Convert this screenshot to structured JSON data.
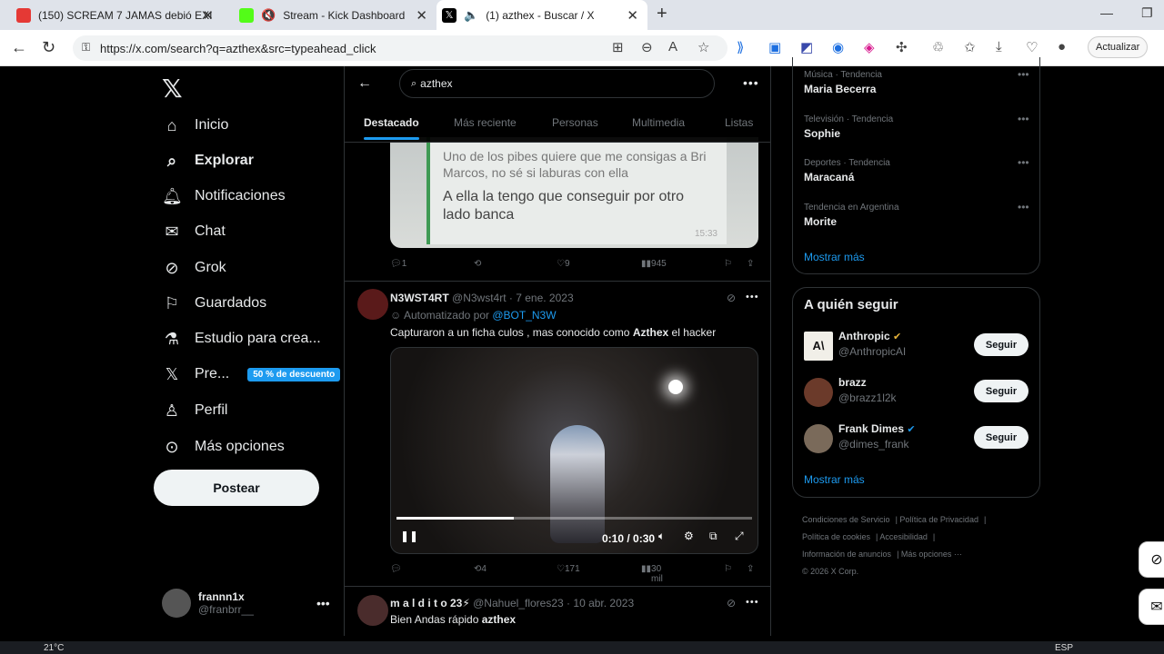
{
  "browser": {
    "tabs": [
      {
        "title": "(150) SCREAM 7 JAMAS debió EXI",
        "favicon_color": "#e53935"
      },
      {
        "title": "Stream - Kick Dashboard",
        "favicon_color": "#53fc18"
      },
      {
        "title": "(1) azthex - Buscar / X",
        "favicon_color": "#000000"
      }
    ],
    "url": "https://x.com/search?q=azthex&src=typeahead_click",
    "update_label": "Actualizar"
  },
  "nav": {
    "items": [
      {
        "label": "Inicio",
        "icon": "home-icon"
      },
      {
        "label": "Explorar",
        "icon": "search-icon"
      },
      {
        "label": "Notificaciones",
        "icon": "bell-icon"
      },
      {
        "label": "Chat",
        "icon": "mail-icon"
      },
      {
        "label": "Grok",
        "icon": "grok-icon"
      },
      {
        "label": "Guardados",
        "icon": "bookmark-icon"
      },
      {
        "label": "Estudio para crea...",
        "icon": "studio-icon"
      },
      {
        "label": "Pre...",
        "icon": "x-premium-icon"
      },
      {
        "label": "Perfil",
        "icon": "person-icon"
      },
      {
        "label": "Más opciones",
        "icon": "more-circle-icon"
      }
    ],
    "promo_badge": "50 % de descuento",
    "post_button": "Postear",
    "account": {
      "name": "frannn1x",
      "handle": "@franbrr__"
    }
  },
  "search": {
    "query": "azthex",
    "tabs": [
      "Destacado",
      "Más reciente",
      "Personas",
      "Multimedia",
      "Listas"
    ]
  },
  "tweets": [
    {
      "image_lines": [
        "Uno de los pibes quiere que me consigas a Bri Marcos, no sé si laburas con ella",
        "A ella la tengo que conseguir por otro lado banca",
        "15:33"
      ],
      "replies": "1",
      "retweets": "",
      "likes": "9",
      "views": "945"
    },
    {
      "name": "N3WST4RT",
      "handle": "@N3wst4rt",
      "date": "7 ene. 2023",
      "automated_prefix": "Automatizado por",
      "automated_by": "@BOT_N3W",
      "text_before": "Capturaron a un ficha culos , mas conocido como",
      "text_bold": "Azthex",
      "text_after": "el hacker",
      "video_time": "0:10 / 0:30",
      "video_progress": 0.33,
      "replies": "",
      "retweets": "4",
      "likes": "171",
      "views": "30 mil"
    },
    {
      "name": "m a l d i t o 23⚡",
      "handle": "@Nahuel_flores23",
      "date": "10 abr. 2023",
      "text_before": "Bien Andas rápido",
      "text_bold": "azthex"
    }
  ],
  "trends": [
    {
      "category": "Música · Tendencia",
      "name": "Maria Becerra"
    },
    {
      "category": "Televisión · Tendencia",
      "name": "Sophie"
    },
    {
      "category": "Deportes · Tendencia",
      "name": "Maracaná"
    },
    {
      "category": "Tendencia en Argentina",
      "name": "Morite"
    }
  ],
  "trends_show_more": "Mostrar más",
  "who_to_follow": {
    "title": "A quién seguir",
    "users": [
      {
        "name": "Anthropic",
        "handle": "@AnthropicAI",
        "avatar_text": "A\\"
      },
      {
        "name": "brazz",
        "handle": "@brazz1l2k"
      },
      {
        "name": "Frank Dimes",
        "handle": "@dimes_frank"
      }
    ],
    "follow_label": "Seguir",
    "show_more": "Mostrar más"
  },
  "footer": [
    "Condiciones de Servicio",
    "Política de Privacidad",
    "Política de cookies",
    "Accesibilidad",
    "Información de anuncios",
    "Más opciones ···",
    "© 2026 X Corp."
  ],
  "taskbar": {
    "temp": "21°C",
    "lang": "ESP"
  }
}
